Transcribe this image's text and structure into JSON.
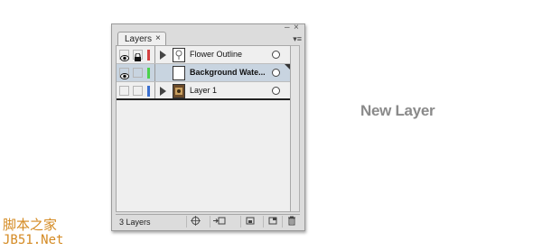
{
  "panel": {
    "tab_label": "Layers",
    "tab_close": "×",
    "minimize": "‒",
    "close": "×",
    "menu": "▾≡",
    "layers": [
      {
        "name": "Flower Outline",
        "visible": true,
        "locked": true,
        "color": "#d44040",
        "expanded": false,
        "selected": false
      },
      {
        "name": "Background Wate...",
        "visible": true,
        "locked": false,
        "color": "#4cd24c",
        "expanded": null,
        "selected": true
      },
      {
        "name": "Layer 1",
        "visible": false,
        "locked": false,
        "color": "#3a6fd0",
        "expanded": false,
        "selected": false
      }
    ],
    "layer_count": "3 Layers"
  },
  "caption": "New Layer",
  "watermark": {
    "line1": "脚本之家",
    "line2": "JB51.Net"
  }
}
